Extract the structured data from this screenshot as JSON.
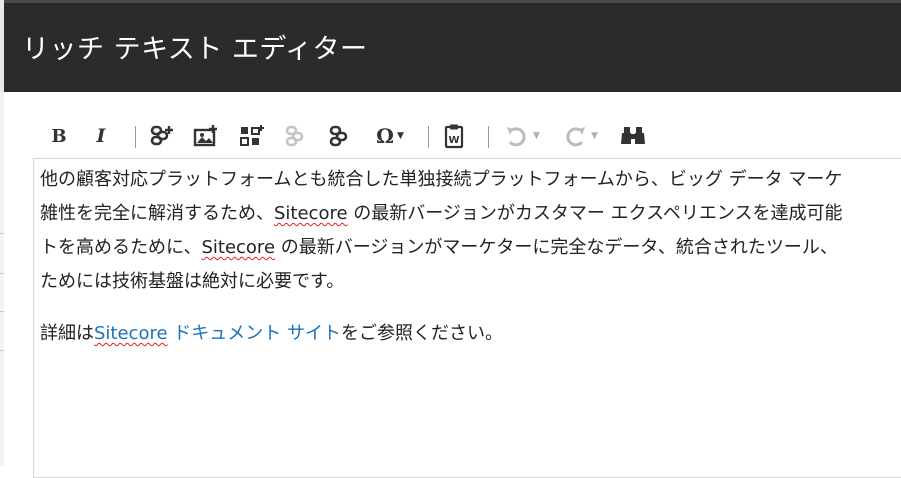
{
  "dialog": {
    "title": "リッチ テキスト エディター"
  },
  "toolbar": {
    "bold_label": "B",
    "italic_label": "I",
    "omega_label": "Ω",
    "buttons": [
      {
        "name": "bold",
        "icon": "bold-icon"
      },
      {
        "name": "italic",
        "icon": "italic-icon"
      },
      {
        "name": "insert-link",
        "icon": "link-add-icon"
      },
      {
        "name": "insert-media",
        "icon": "image-icon"
      },
      {
        "name": "insert-layout",
        "icon": "grid-icon"
      },
      {
        "name": "remove-link",
        "icon": "unlink-icon",
        "disabled": true
      },
      {
        "name": "sitecore-link",
        "icon": "link-icon"
      },
      {
        "name": "special-chars",
        "icon": "omega-icon"
      },
      {
        "name": "paste-word",
        "icon": "clipboard-word-icon"
      },
      {
        "name": "undo",
        "icon": "undo-icon",
        "disabled": true
      },
      {
        "name": "redo",
        "icon": "redo-icon",
        "disabled": true
      },
      {
        "name": "find",
        "icon": "binoculars-icon"
      }
    ]
  },
  "editor": {
    "paragraph1": {
      "line1": "他の顧客対応プラットフォームとも統合した単独接続プラットフォームから、ビッグ データ マーケ",
      "line2_pre": "雑性を完全に解消するため、",
      "line2_sitecore": "Sitecore",
      "line2_post": " の最新バージョンがカスタマー エクスペリエンスを達成可能",
      "line3_pre": "トを高めるために、",
      "line3_sitecore": "Sitecore",
      "line3_post": " の最新バージョンがマーケターに完全なデータ、統合されたツール、",
      "line4": "ためには技術基盤は絶対に必要です。"
    },
    "paragraph2": {
      "pre": "詳細は",
      "link_sitecore": "Sitecore",
      "link_rest": " ドキュメント サイト",
      "post": "をご参照ください。"
    }
  },
  "colors": {
    "titlebar": "#2b2b2b",
    "link": "#1a73b8",
    "spellcheck": "#e02020"
  }
}
